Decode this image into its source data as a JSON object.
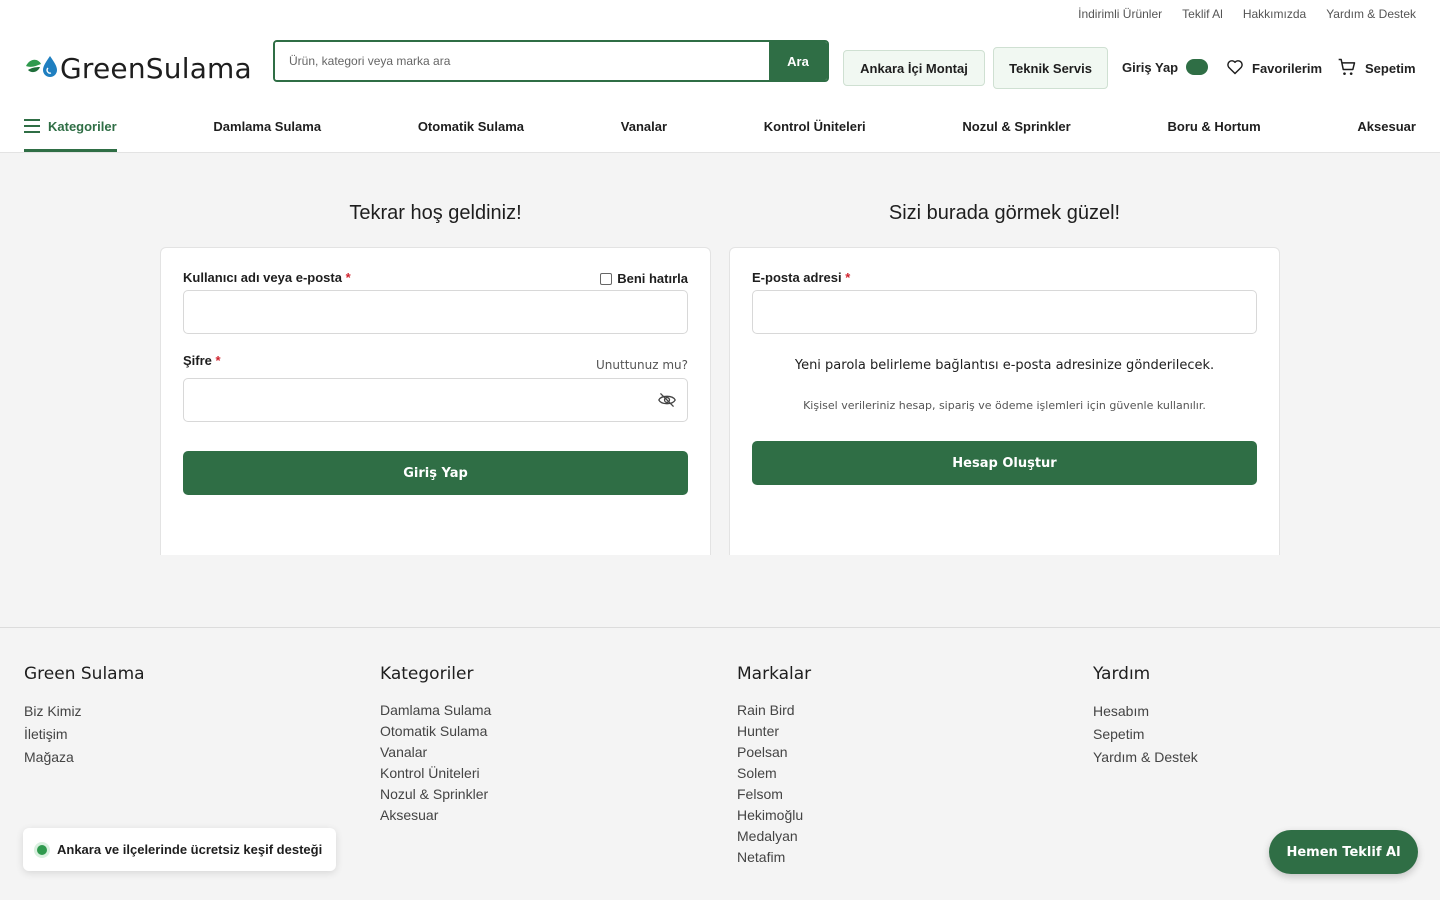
{
  "topbar": {
    "links": [
      "İndirimli Ürünler",
      "Teklif Al",
      "Hakkımızda",
      "Yardım & Destek"
    ]
  },
  "header": {
    "logo_text": "GreenSulama",
    "search_placeholder": "Ürün, kategori veya marka ara",
    "search_button": "Ara",
    "montaj_button": "Ankara İçi Montaj",
    "servis_button": "Teknik Servis",
    "login_label": "Giriş Yap",
    "favorites_label": "Favorilerim",
    "cart_label": "Sepetim"
  },
  "nav": {
    "categories_label": "Kategoriler",
    "items": [
      "Damlama Sulama",
      "Otomatik Sulama",
      "Vanalar",
      "Kontrol Üniteleri",
      "Nozul & Sprinkler",
      "Boru & Hortum",
      "Aksesuar"
    ]
  },
  "login": {
    "heading": "Tekrar hoş geldiniz!",
    "username_label": "Kullanıcı adı veya e-posta",
    "required_mark": "*",
    "remember_label": "Beni hatırla",
    "password_label": "Şifre",
    "forgot_label": "Unuttunuz mu?",
    "submit_label": "Giriş Yap"
  },
  "register": {
    "heading": "Sizi burada görmek güzel!",
    "email_label": "E-posta adresi",
    "required_mark": "*",
    "info_text": "Yeni parola belirleme bağlantısı e-posta adresinize gönderilecek.",
    "privacy_text": "Kişisel verileriniz hesap, sipariş ve ödeme işlemleri için güvenle kullanılır.",
    "submit_label": "Hesap Oluştur"
  },
  "footer": {
    "col1": {
      "title": "Green Sulama",
      "items": [
        "Biz Kimiz",
        "İletişim",
        "Mağaza"
      ]
    },
    "col2": {
      "title": "Kategoriler",
      "items": [
        "Damlama Sulama",
        "Otomatik Sulama",
        "Vanalar",
        "Kontrol Üniteleri",
        "Nozul & Sprinkler",
        "Aksesuar"
      ]
    },
    "col3": {
      "title": "Markalar",
      "items": [
        "Rain Bird",
        "Hunter",
        "Poelsan",
        "Solem",
        "Felsom",
        "Hekimoğlu",
        "Medalyan",
        "Netafim"
      ]
    },
    "col4": {
      "title": "Yardım",
      "items": [
        "Hesabım",
        "Sepetim",
        "Yardım & Destek"
      ]
    }
  },
  "toast": {
    "text": "Ankara ve ilçelerinde ücretsiz keşif desteği"
  },
  "cta": {
    "label": "Hemen Teklif Al"
  },
  "colors": {
    "brand": "#2f6e45",
    "required": "#d0232e",
    "background": "#f4f4f4"
  },
  "icons": [
    "leaf-drop-logo-icon",
    "heart-icon",
    "cart-icon",
    "eye-off-icon",
    "hamburger-icon",
    "status-dot-icon"
  ]
}
